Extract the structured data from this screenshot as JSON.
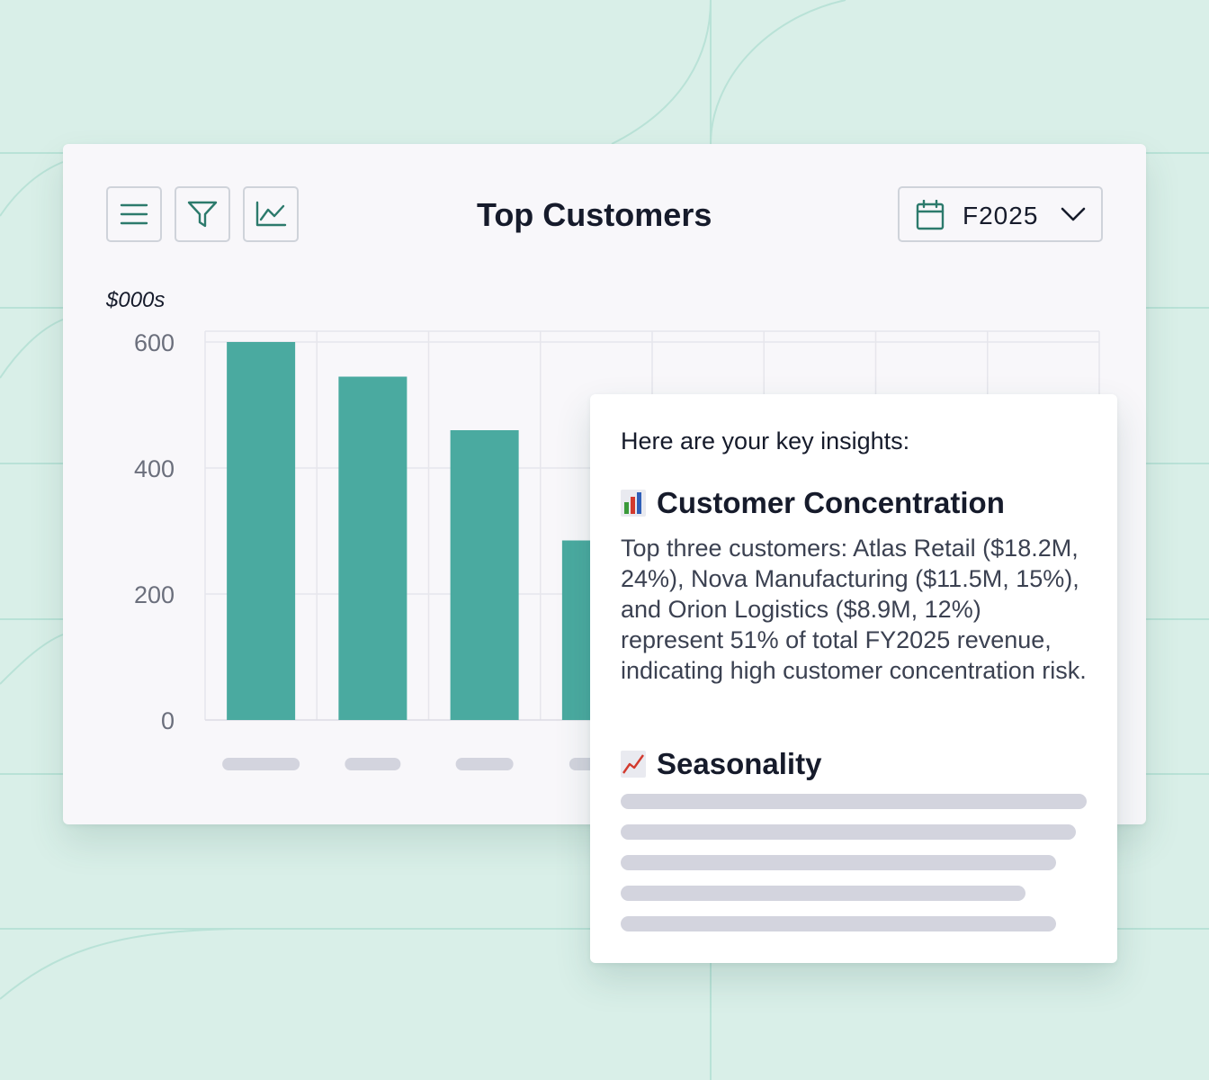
{
  "toolbar": {
    "menu_icon": "hamburger-menu-icon",
    "filter_icon": "filter-funnel-icon",
    "chart_icon": "line-chart-icon"
  },
  "header": {
    "title": "Top Customers",
    "period_label": "F2025",
    "period_icon": "calendar-icon",
    "dropdown_icon": "chevron-down-icon"
  },
  "colors": {
    "background": "#d9efe8",
    "accent": "#4aaaa0",
    "text": "#161b2b",
    "skeleton": "#d3d4de"
  },
  "chart_data": {
    "type": "bar",
    "unit_label": "$000s",
    "ylim": [
      0,
      600
    ],
    "yticks": [
      "600",
      "400",
      "200",
      "0"
    ],
    "values": [
      600,
      545,
      460,
      285
    ],
    "category_labels_visible": false,
    "grid": true
  },
  "insights": {
    "intro": "Here are your key insights:",
    "sections": [
      {
        "icon": "bar-chart-emoji",
        "title": "Customer Concentration",
        "text": "Top three customers: Atlas Retail ($18.2M, 24%), Nova Manufacturing ($11.5M, 15%), and Orion Logistics ($8.9M, 12%) represent 51% of total FY2025 revenue, indicating high customer concentration risk."
      },
      {
        "icon": "trending-up-chart-emoji",
        "title": "Seasonality"
      }
    ]
  }
}
